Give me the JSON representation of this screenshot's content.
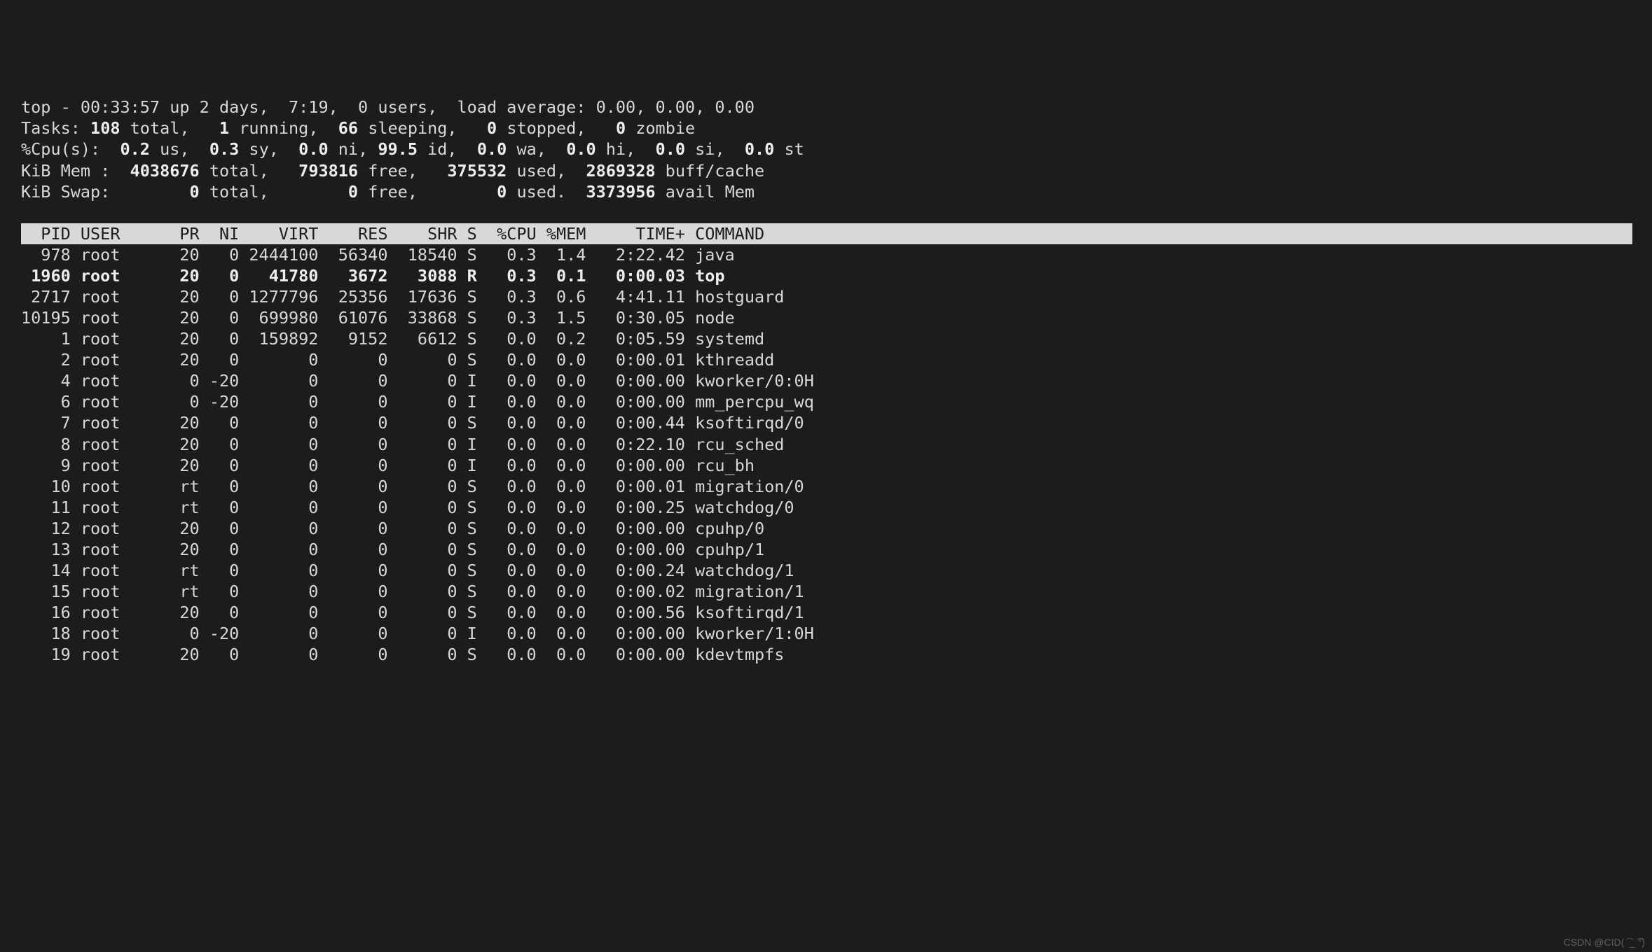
{
  "summary": {
    "line1_pre": "top - ",
    "time": "00:33:57",
    "line1_post": " up 2 days,  7:19,  0 users,  load average: 0.00, 0.00, 0.00",
    "tasks_label": "Tasks: ",
    "tasks_total": "108",
    "tasks_total_lbl": " total,   ",
    "tasks_running": "1",
    "tasks_running_lbl": " running,  ",
    "tasks_sleeping": "66",
    "tasks_sleeping_lbl": " sleeping,   ",
    "tasks_stopped": "0",
    "tasks_stopped_lbl": " stopped,   ",
    "tasks_zombie": "0",
    "tasks_zombie_lbl": " zombie",
    "cpu_label": "%Cpu(s):  ",
    "cpu_us": "0.2",
    "cpu_us_lbl": " us,  ",
    "cpu_sy": "0.3",
    "cpu_sy_lbl": " sy,  ",
    "cpu_ni": "0.0",
    "cpu_ni_lbl": " ni, ",
    "cpu_id": "99.5",
    "cpu_id_lbl": " id,  ",
    "cpu_wa": "0.0",
    "cpu_wa_lbl": " wa,  ",
    "cpu_hi": "0.0",
    "cpu_hi_lbl": " hi,  ",
    "cpu_si": "0.0",
    "cpu_si_lbl": " si,  ",
    "cpu_st": "0.0",
    "cpu_st_lbl": " st",
    "mem_label": "KiB Mem :  ",
    "mem_total": "4038676",
    "mem_total_lbl": " total,   ",
    "mem_free": "793816",
    "mem_free_lbl": " free,   ",
    "mem_used": "375532",
    "mem_used_lbl": " used,  ",
    "mem_buff": "2869328",
    "mem_buff_lbl": " buff/cache",
    "swap_label": "KiB Swap:        ",
    "swap_total": "0",
    "swap_total_lbl": " total,        ",
    "swap_free": "0",
    "swap_free_lbl": " free,        ",
    "swap_used": "0",
    "swap_used_lbl": " used.  ",
    "swap_avail": "3373956",
    "swap_avail_lbl": " avail Mem"
  },
  "columns": [
    "PID",
    "USER",
    "PR",
    "NI",
    "VIRT",
    "RES",
    "SHR",
    "S",
    "%CPU",
    "%MEM",
    "TIME+",
    "COMMAND"
  ],
  "widths": [
    5,
    8,
    5,
    4,
    8,
    7,
    7,
    2,
    5,
    5,
    9,
    20
  ],
  "gap": " ",
  "align": [
    "r",
    "l",
    "r",
    "r",
    "r",
    "r",
    "r",
    "l",
    "r",
    "r",
    "r",
    "l"
  ],
  "header_text": "  PID USER      PR  NI    VIRT    RES    SHR S  %CPU %MEM     TIME+ COMMAND",
  "processes": [
    {
      "pid": "978",
      "user": "root",
      "pr": "20",
      "ni": "0",
      "virt": "2444100",
      "res": "56340",
      "shr": "18540",
      "s": "S",
      "cpu": "0.3",
      "mem": "1.4",
      "time": "2:22.42",
      "cmd": "java",
      "bold": false
    },
    {
      "pid": "1960",
      "user": "root",
      "pr": "20",
      "ni": "0",
      "virt": "41780",
      "res": "3672",
      "shr": "3088",
      "s": "R",
      "cpu": "0.3",
      "mem": "0.1",
      "time": "0:00.03",
      "cmd": "top",
      "bold": true
    },
    {
      "pid": "2717",
      "user": "root",
      "pr": "20",
      "ni": "0",
      "virt": "1277796",
      "res": "25356",
      "shr": "17636",
      "s": "S",
      "cpu": "0.3",
      "mem": "0.6",
      "time": "4:41.11",
      "cmd": "hostguard",
      "bold": false
    },
    {
      "pid": "10195",
      "user": "root",
      "pr": "20",
      "ni": "0",
      "virt": "699980",
      "res": "61076",
      "shr": "33868",
      "s": "S",
      "cpu": "0.3",
      "mem": "1.5",
      "time": "0:30.05",
      "cmd": "node",
      "bold": false
    },
    {
      "pid": "1",
      "user": "root",
      "pr": "20",
      "ni": "0",
      "virt": "159892",
      "res": "9152",
      "shr": "6612",
      "s": "S",
      "cpu": "0.0",
      "mem": "0.2",
      "time": "0:05.59",
      "cmd": "systemd",
      "bold": false
    },
    {
      "pid": "2",
      "user": "root",
      "pr": "20",
      "ni": "0",
      "virt": "0",
      "res": "0",
      "shr": "0",
      "s": "S",
      "cpu": "0.0",
      "mem": "0.0",
      "time": "0:00.01",
      "cmd": "kthreadd",
      "bold": false
    },
    {
      "pid": "4",
      "user": "root",
      "pr": "0",
      "ni": "-20",
      "virt": "0",
      "res": "0",
      "shr": "0",
      "s": "I",
      "cpu": "0.0",
      "mem": "0.0",
      "time": "0:00.00",
      "cmd": "kworker/0:0H",
      "bold": false
    },
    {
      "pid": "6",
      "user": "root",
      "pr": "0",
      "ni": "-20",
      "virt": "0",
      "res": "0",
      "shr": "0",
      "s": "I",
      "cpu": "0.0",
      "mem": "0.0",
      "time": "0:00.00",
      "cmd": "mm_percpu_wq",
      "bold": false
    },
    {
      "pid": "7",
      "user": "root",
      "pr": "20",
      "ni": "0",
      "virt": "0",
      "res": "0",
      "shr": "0",
      "s": "S",
      "cpu": "0.0",
      "mem": "0.0",
      "time": "0:00.44",
      "cmd": "ksoftirqd/0",
      "bold": false
    },
    {
      "pid": "8",
      "user": "root",
      "pr": "20",
      "ni": "0",
      "virt": "0",
      "res": "0",
      "shr": "0",
      "s": "I",
      "cpu": "0.0",
      "mem": "0.0",
      "time": "0:22.10",
      "cmd": "rcu_sched",
      "bold": false
    },
    {
      "pid": "9",
      "user": "root",
      "pr": "20",
      "ni": "0",
      "virt": "0",
      "res": "0",
      "shr": "0",
      "s": "I",
      "cpu": "0.0",
      "mem": "0.0",
      "time": "0:00.00",
      "cmd": "rcu_bh",
      "bold": false
    },
    {
      "pid": "10",
      "user": "root",
      "pr": "rt",
      "ni": "0",
      "virt": "0",
      "res": "0",
      "shr": "0",
      "s": "S",
      "cpu": "0.0",
      "mem": "0.0",
      "time": "0:00.01",
      "cmd": "migration/0",
      "bold": false
    },
    {
      "pid": "11",
      "user": "root",
      "pr": "rt",
      "ni": "0",
      "virt": "0",
      "res": "0",
      "shr": "0",
      "s": "S",
      "cpu": "0.0",
      "mem": "0.0",
      "time": "0:00.25",
      "cmd": "watchdog/0",
      "bold": false
    },
    {
      "pid": "12",
      "user": "root",
      "pr": "20",
      "ni": "0",
      "virt": "0",
      "res": "0",
      "shr": "0",
      "s": "S",
      "cpu": "0.0",
      "mem": "0.0",
      "time": "0:00.00",
      "cmd": "cpuhp/0",
      "bold": false
    },
    {
      "pid": "13",
      "user": "root",
      "pr": "20",
      "ni": "0",
      "virt": "0",
      "res": "0",
      "shr": "0",
      "s": "S",
      "cpu": "0.0",
      "mem": "0.0",
      "time": "0:00.00",
      "cmd": "cpuhp/1",
      "bold": false
    },
    {
      "pid": "14",
      "user": "root",
      "pr": "rt",
      "ni": "0",
      "virt": "0",
      "res": "0",
      "shr": "0",
      "s": "S",
      "cpu": "0.0",
      "mem": "0.0",
      "time": "0:00.24",
      "cmd": "watchdog/1",
      "bold": false
    },
    {
      "pid": "15",
      "user": "root",
      "pr": "rt",
      "ni": "0",
      "virt": "0",
      "res": "0",
      "shr": "0",
      "s": "S",
      "cpu": "0.0",
      "mem": "0.0",
      "time": "0:00.02",
      "cmd": "migration/1",
      "bold": false
    },
    {
      "pid": "16",
      "user": "root",
      "pr": "20",
      "ni": "0",
      "virt": "0",
      "res": "0",
      "shr": "0",
      "s": "S",
      "cpu": "0.0",
      "mem": "0.0",
      "time": "0:00.56",
      "cmd": "ksoftirqd/1",
      "bold": false
    },
    {
      "pid": "18",
      "user": "root",
      "pr": "0",
      "ni": "-20",
      "virt": "0",
      "res": "0",
      "shr": "0",
      "s": "I",
      "cpu": "0.0",
      "mem": "0.0",
      "time": "0:00.00",
      "cmd": "kworker/1:0H",
      "bold": false
    },
    {
      "pid": "19",
      "user": "root",
      "pr": "20",
      "ni": "0",
      "virt": "0",
      "res": "0",
      "shr": "0",
      "s": "S",
      "cpu": "0.0",
      "mem": "0.0",
      "time": "0:00.00",
      "cmd": "kdevtmpfs",
      "bold": false
    }
  ],
  "watermark": "CSDN @CID( ͡ _ ͡°)"
}
